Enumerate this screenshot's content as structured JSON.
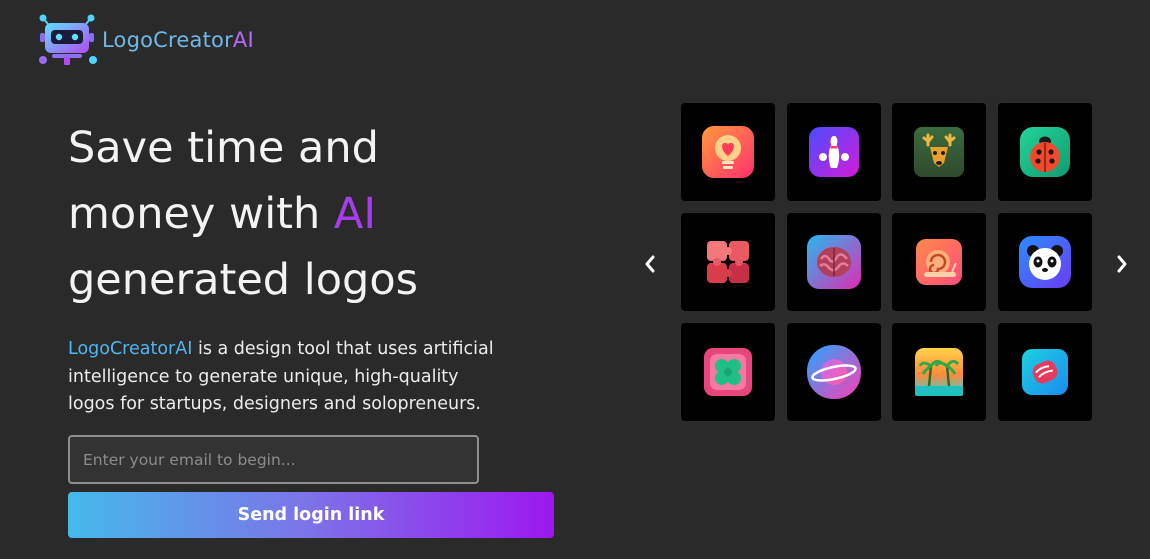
{
  "brand": {
    "name_part1": "LogoCreator",
    "name_part2": "AI",
    "logo_icon": "robot-icon"
  },
  "hero": {
    "headline_line1": "Save time and",
    "headline_line2_pre": "money with ",
    "headline_accent": "AI",
    "headline_line3": "generated logos",
    "description_brand": "LogoCreatorAI",
    "description_rest": " is a design tool that uses artificial intelligence to generate unique, high-quality logos for startups, designers and solopreneurs."
  },
  "signup": {
    "email_placeholder": "Enter your email to begin...",
    "email_value": "",
    "submit_label": "Send login link"
  },
  "carousel": {
    "prev_icon": "chevron-left-icon",
    "next_icon": "chevron-right-icon",
    "logos": [
      {
        "icon": "lightbulb-heart-icon"
      },
      {
        "icon": "bowling-icon"
      },
      {
        "icon": "deer-icon"
      },
      {
        "icon": "ladybug-icon"
      },
      {
        "icon": "puzzle-icon"
      },
      {
        "icon": "brain-icon"
      },
      {
        "icon": "snail-icon"
      },
      {
        "icon": "panda-icon"
      },
      {
        "icon": "clover-icon"
      },
      {
        "icon": "planet-icon"
      },
      {
        "icon": "palm-trees-icon"
      },
      {
        "icon": "sushi-icon"
      }
    ]
  },
  "colors": {
    "background": "#2b2a2b",
    "accent_purple": "#a83df0",
    "accent_blue": "#4fb6f0",
    "button_gradient_start": "#45b9ea",
    "button_gradient_end": "#9d17ef"
  }
}
